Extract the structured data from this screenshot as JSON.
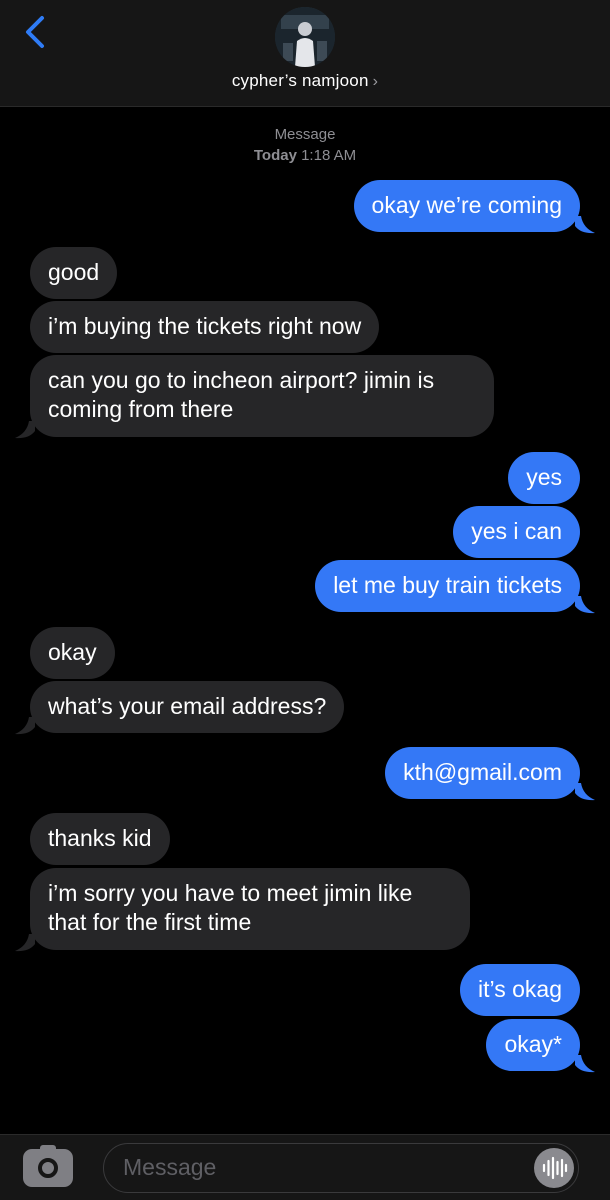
{
  "header": {
    "contact_name": "cypher’s namjoon",
    "chevron": "›"
  },
  "meta": {
    "service": "Message",
    "day": "Today",
    "time": "1:18 AM"
  },
  "messages": [
    {
      "from": "me",
      "text": "okay we’re coming"
    },
    {
      "from": "them",
      "text": "good"
    },
    {
      "from": "them",
      "text": "i’m buying the tickets right now"
    },
    {
      "from": "them",
      "text": "can you go to incheon airport? jimin is coming from there"
    },
    {
      "from": "me",
      "text": "yes"
    },
    {
      "from": "me",
      "text": "yes i can"
    },
    {
      "from": "me",
      "text": "let me buy train tickets"
    },
    {
      "from": "them",
      "text": "okay"
    },
    {
      "from": "them",
      "text": "what’s your email address?"
    },
    {
      "from": "me",
      "text": "kth@gmail.com"
    },
    {
      "from": "them",
      "text": "thanks kid"
    },
    {
      "from": "them",
      "text": "i’m sorry you have to meet jimin like that for the first time"
    },
    {
      "from": "me",
      "text": "it’s okag"
    },
    {
      "from": "me",
      "text": "okay*"
    }
  ],
  "composer": {
    "placeholder": "Message",
    "camera_icon": "camera-icon",
    "audio_icon": "audio-waveform-icon"
  },
  "colors": {
    "outgoing_bubble": "#3478f6",
    "incoming_bubble": "#262628",
    "background": "#000000",
    "accent": "#2f7cf6"
  }
}
